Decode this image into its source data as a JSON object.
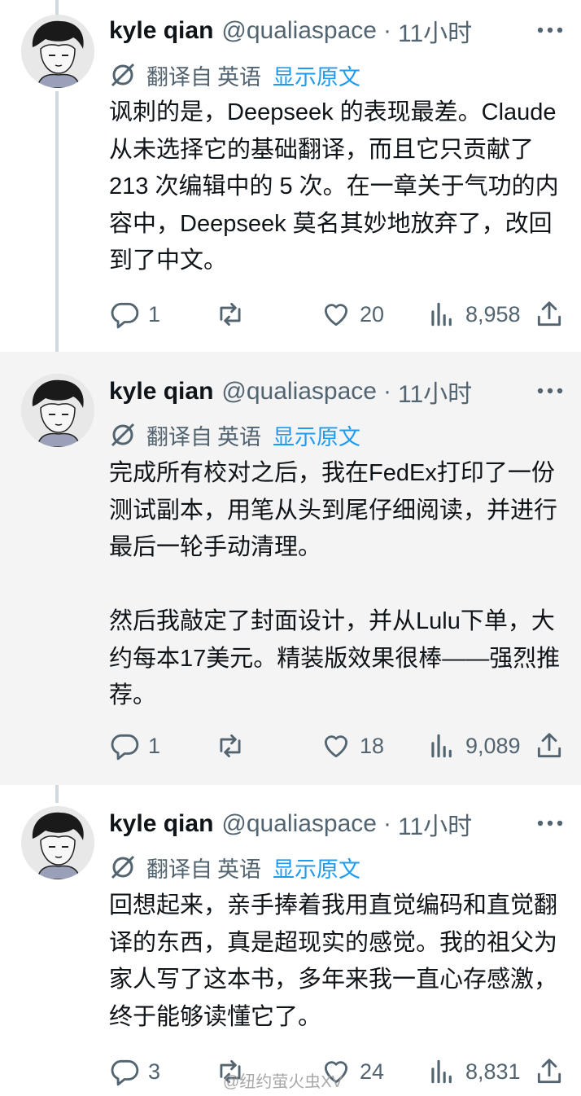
{
  "thread": {
    "tweets": [
      {
        "name": "kyle qian",
        "handle": "@qualiaspace",
        "dot": "·",
        "time": "11小时",
        "translate": {
          "label": "翻译自",
          "lang": "英语",
          "show_original": "显示原文"
        },
        "text": "讽刺的是，Deepseek 的表现最差。Claude 从未选择它的基础翻译，而且它只贡献了 213 次编辑中的 5 次。在一章关于气功的内容中，Deepseek 莫名其妙地放弃了，改回到了中文。",
        "replies": "1",
        "retweets": "",
        "likes": "20",
        "views": "8,958"
      },
      {
        "name": "kyle qian",
        "handle": "@qualiaspace",
        "dot": "·",
        "time": "11小时",
        "translate": {
          "label": "翻译自",
          "lang": "英语",
          "show_original": "显示原文"
        },
        "text": "完成所有校对之后，我在FedEx打印了一份测试副本，用笔从头到尾仔细阅读，并进行最后一轮手动清理。\n\n然后我敲定了封面设计，并从Lulu下单，大约每本17美元。精装版效果很棒——强烈推荐。",
        "replies": "1",
        "retweets": "",
        "likes": "18",
        "views": "9,089"
      },
      {
        "name": "kyle qian",
        "handle": "@qualiaspace",
        "dot": "·",
        "time": "11小时",
        "translate": {
          "label": "翻译自",
          "lang": "英语",
          "show_original": "显示原文"
        },
        "text": "回想起来，亲手捧着我用直觉编码和直觉翻译的东西，真是超现实的感觉。我的祖父为家人写了这本书，多年来我一直心存感激，终于能够读懂它了。",
        "replies": "3",
        "retweets": "",
        "likes": "24",
        "views": "8,831"
      }
    ]
  },
  "watermark": "@纽约萤火虫XV",
  "colors": {
    "link": "#1d9bf0",
    "secondary": "#536471",
    "text": "#0f1419",
    "thread_line": "#cfd9de",
    "shaded_bg": "#f4f4f4"
  },
  "icons": [
    "avatar",
    "translate-icon",
    "more-icon",
    "reply-icon",
    "retweet-icon",
    "like-icon",
    "views-icon",
    "share-icon"
  ]
}
